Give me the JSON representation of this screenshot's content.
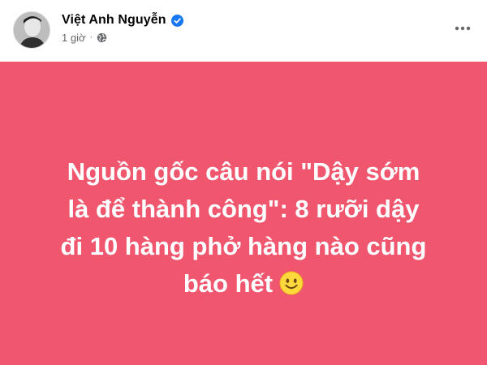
{
  "post": {
    "author": {
      "name": "Việt Anh Nguyễn",
      "verified": true
    },
    "meta": {
      "time": "1 giờ",
      "separator": "·",
      "privacy_icon": "globe-icon"
    },
    "more_icon": "more-horizontal-icon",
    "content": {
      "background_color": "#f0566e",
      "text_color": "#ffffff",
      "line1": "Nguồn gốc câu nói \"Dậy sớm",
      "line2": "là để thành công\": 8 rưỡi dậy",
      "line3": "đi 10 hàng phở hàng nào cũng",
      "line4": "báo hết",
      "emoji": "slightly-smiling-face-emoji"
    }
  },
  "colors": {
    "verified_badge": "#1877f2",
    "meta_text": "#65676b",
    "name_text": "#050505"
  }
}
